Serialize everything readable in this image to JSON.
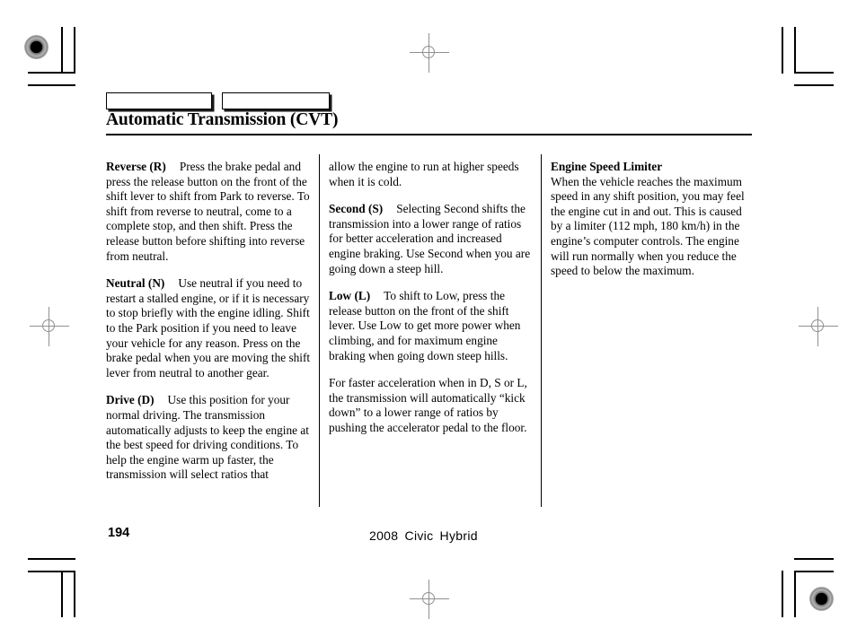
{
  "document": {
    "page_title": "Automatic Transmission (CVT)",
    "tabs": [
      {
        "label": ""
      },
      {
        "label": ""
      }
    ],
    "footer": {
      "page_number": "194",
      "model": "2008  Civic  Hybrid"
    }
  },
  "columns": {
    "column1": {
      "paragraphs": [
        {
          "lead": "Reverse (R)",
          "body": "Press the brake pedal and press the release button on the front of the shift lever to shift from Park to reverse. To shift from reverse to neutral, come to a complete stop, and then shift. Press the release button before shifting into reverse from neutral."
        },
        {
          "lead": "Neutral (N)",
          "body": "Use neutral if you need to restart a stalled engine, or if it is necessary to stop briefly with the engine idling. Shift to the Park position if you need to leave your vehicle for any reason. Press on the brake pedal when you are moving the shift lever from neutral to another gear."
        },
        {
          "lead": "Drive (D)",
          "body": "Use this position for your normal driving. The transmission automatically adjusts to keep the engine at the best speed for driving conditions. To help the engine warm up faster, the transmission will select ratios that"
        }
      ]
    },
    "column2": {
      "paragraphs": [
        {
          "lead": "",
          "body": "allow the engine to run at higher speeds when it is cold."
        },
        {
          "lead": "Second (S)",
          "body": "Selecting Second shifts the transmission into a lower range of ratios for better acceleration and increased engine braking. Use Second when you are going down a steep hill."
        },
        {
          "lead": "Low (L)",
          "body": "To shift to Low, press the release button on the front of the shift lever. Use Low to get more power when climbing, and for maximum engine braking when going down steep hills."
        },
        {
          "lead": "",
          "body": "For faster acceleration when in D, S or L, the transmission will automatically “kick down” to a lower range of ratios by pushing the accelerator pedal to the floor."
        }
      ]
    },
    "column3": {
      "heading": "Engine Speed Limiter",
      "body": "When the vehicle reaches the maximum speed in any shift position, you may feel the engine cut in and out. This is caused by a limiter (112 mph, 180 km/h) in the engine’s computer controls. The engine will run normally when you reduce the speed to below the maximum."
    }
  },
  "print_marks": {
    "registration_icon": "registration-target-icon",
    "crosshair_icon": "crosshair-registration-icon",
    "crop_mark_icon": "crop-mark-icon"
  }
}
